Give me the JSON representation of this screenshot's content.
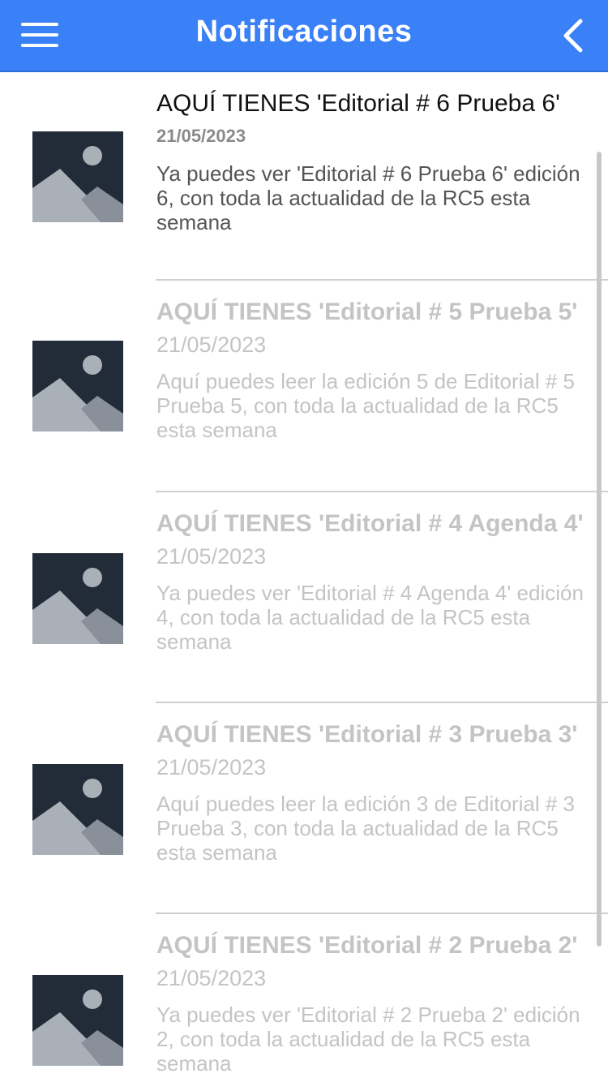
{
  "header": {
    "title": "Notificaciones",
    "menu_icon": "hamburger-menu-icon",
    "back_icon": "chevron-left-icon",
    "background_color": "#3a80f7"
  },
  "notifications": [
    {
      "title": "AQUÍ TIENES 'Editorial # 6 Prueba 6'",
      "date": "21/05/2023",
      "body": "Ya puedes ver 'Editorial # 6 Prueba 6' edición 6, con toda la actualidad de la RC5 esta semana",
      "read": false,
      "thumbnail_icon": "image-placeholder-icon"
    },
    {
      "title": "AQUÍ TIENES 'Editorial # 5 Prueba 5'",
      "date": "21/05/2023",
      "body": "Aquí puedes leer la edición 5 de Editorial # 5 Prueba 5, con toda la actualidad de la RC5 esta semana",
      "read": true,
      "thumbnail_icon": "image-placeholder-icon"
    },
    {
      "title": "AQUÍ TIENES 'Editorial # 4 Agenda 4'",
      "date": "21/05/2023",
      "body": "Ya puedes ver 'Editorial # 4 Agenda 4' edición 4, con toda la actualidad de la RC5 esta semana",
      "read": true,
      "thumbnail_icon": "image-placeholder-icon"
    },
    {
      "title": "AQUÍ TIENES 'Editorial # 3 Prueba 3'",
      "date": "21/05/2023",
      "body": "Aquí puedes leer la edición 3 de Editorial # 3 Prueba 3, con toda la actualidad de la RC5 esta semana",
      "read": true,
      "thumbnail_icon": "image-placeholder-icon"
    },
    {
      "title": "AQUÍ TIENES 'Editorial # 2 Prueba 2'",
      "date": "21/05/2023",
      "body": "Ya puedes ver 'Editorial # 2 Prueba 2' edición 2, con toda la actualidad de la RC5 esta semana",
      "read": true,
      "thumbnail_icon": "image-placeholder-icon"
    }
  ]
}
